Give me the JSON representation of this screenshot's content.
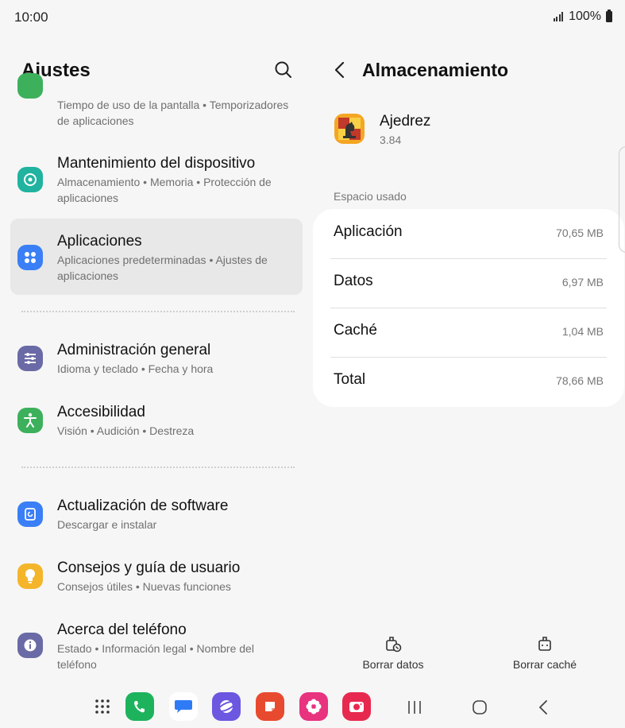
{
  "status_bar": {
    "time": "10:00",
    "battery": "100%",
    "icons": [
      "signal-icon",
      "battery-icon"
    ]
  },
  "left_pane": {
    "title": "Ajustes",
    "search_icon": "search-icon",
    "items": [
      {
        "id": "digital-wellbeing",
        "icon": "wellbeing-icon",
        "color": "#3db05c",
        "title": "",
        "subtitle": "Tiempo de uso de la pantalla • Temporizadores de aplicaciones"
      },
      {
        "id": "device-care",
        "icon": "device-care-icon",
        "color": "#20b3a0",
        "title": "Mantenimiento del dispositivo",
        "subtitle": "Almacenamiento • Memoria • Protección de aplicaciones"
      },
      {
        "id": "apps",
        "icon": "apps-icon",
        "color": "#3a7ff5",
        "title": "Aplicaciones",
        "subtitle": "Aplicaciones predeterminadas • Ajustes de aplicaciones",
        "selected": true
      },
      {
        "id": "general-management",
        "icon": "sliders-icon",
        "color": "#6a6aa6",
        "title": "Administración general",
        "subtitle": "Idioma y teclado • Fecha y hora"
      },
      {
        "id": "accessibility",
        "icon": "accessibility-icon",
        "color": "#3db05c",
        "title": "Accesibilidad",
        "subtitle": "Visión • Audición • Destreza"
      },
      {
        "id": "software-update",
        "icon": "update-icon",
        "color": "#3a7ff5",
        "title": "Actualización de software",
        "subtitle": "Descargar e instalar"
      },
      {
        "id": "tips",
        "icon": "lightbulb-icon",
        "color": "#f5b52a",
        "title": "Consejos y guía de usuario",
        "subtitle": "Consejos útiles • Nuevas funciones"
      },
      {
        "id": "about-phone",
        "icon": "info-icon",
        "color": "#6a6aa6",
        "title": "Acerca del teléfono",
        "subtitle": "Estado • Información legal • Nombre del teléfono"
      }
    ]
  },
  "right_pane": {
    "title": "Almacenamiento",
    "back_icon": "back-arrow-icon",
    "app": {
      "name": "Ajedrez",
      "version": "3.84",
      "icon": "chess-app-icon"
    },
    "section_label": "Espacio usado",
    "storage_rows": [
      {
        "label": "Aplicación",
        "value": "70,65 MB"
      },
      {
        "label": "Datos",
        "value": "6,97 MB"
      },
      {
        "label": "Caché",
        "value": "1,04 MB"
      },
      {
        "label": "Total",
        "value": "78,66 MB"
      }
    ],
    "actions": [
      {
        "label": "Borrar datos",
        "icon": "clear-data-icon"
      },
      {
        "label": "Borrar caché",
        "icon": "clear-cache-icon"
      }
    ]
  },
  "nav_bar": {
    "dock": [
      {
        "name": "app-drawer-icon",
        "color": "#333333"
      },
      {
        "name": "phone-app-icon",
        "color": "#1db35c"
      },
      {
        "name": "messages-app-icon",
        "color": "#2f7bf5"
      },
      {
        "name": "internet-app-icon",
        "color": "#6b57e0"
      },
      {
        "name": "notes-app-icon",
        "color": "#e84a2f"
      },
      {
        "name": "gallery-app-icon",
        "color": "#e8337f"
      },
      {
        "name": "camera-app-icon",
        "color": "#e8294f"
      }
    ],
    "buttons": [
      "recents-icon",
      "home-icon",
      "back-icon"
    ]
  }
}
